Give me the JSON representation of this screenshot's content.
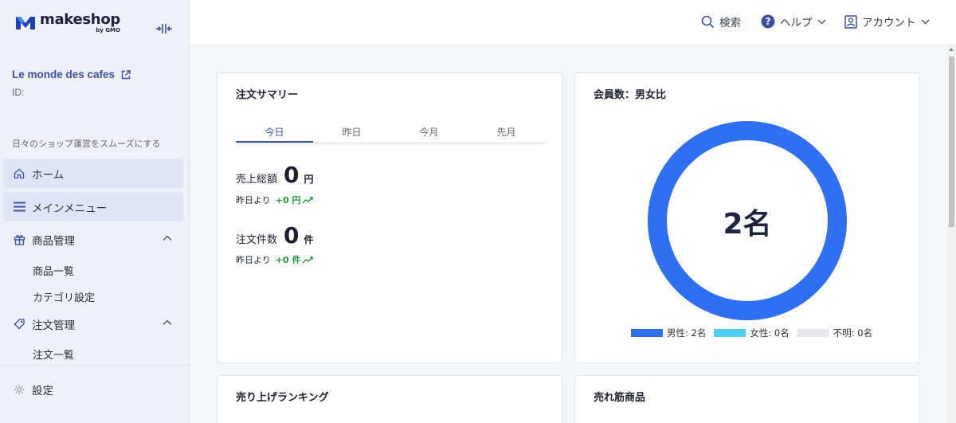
{
  "app": {
    "logo_name": "makeshop",
    "logo_by": "by GMO"
  },
  "sidebar": {
    "shop_name": "Le monde des cafes",
    "shop_id": "ID:",
    "tagline": "日々のショップ運営をスムーズにする",
    "items": [
      {
        "label": "ホーム"
      },
      {
        "label": "メインメニュー"
      },
      {
        "label": "商品管理"
      },
      {
        "label": "注文管理"
      }
    ],
    "product_sub": [
      {
        "label": "商品一覧"
      },
      {
        "label": "カテゴリ設定"
      }
    ],
    "order_sub": [
      {
        "label": "注文一覧"
      }
    ],
    "settings_label": "設定"
  },
  "header": {
    "search": "検索",
    "help": "ヘルプ",
    "account": "アカウント"
  },
  "order_summary": {
    "title": "注文サマリー",
    "tabs": [
      "今日",
      "昨日",
      "今月",
      "先月"
    ],
    "sales_label": "売上総額",
    "sales_value": "0",
    "sales_unit": "円",
    "sales_compare_prefix": "昨日より",
    "sales_delta": "+0 円",
    "orders_label": "注文件数",
    "orders_value": "0",
    "orders_unit": "件",
    "orders_compare_prefix": "昨日より",
    "orders_delta": "+0 件"
  },
  "members": {
    "title": "会員数：男女比",
    "total": "2名",
    "legend": [
      {
        "label": "男性: 2名",
        "color": "#2f6ff1"
      },
      {
        "label": "女性: 0名",
        "color": "#4fcdf2"
      },
      {
        "label": "不明: 0名",
        "color": "#e6e6ec"
      }
    ]
  },
  "sales_ranking": {
    "title": "売り上げランキング"
  },
  "best_sellers": {
    "title": "売れ筋商品"
  },
  "colors": {
    "accent": "#3e4fa6",
    "positive": "#1e9c3a",
    "male": "#2f6ff1"
  }
}
